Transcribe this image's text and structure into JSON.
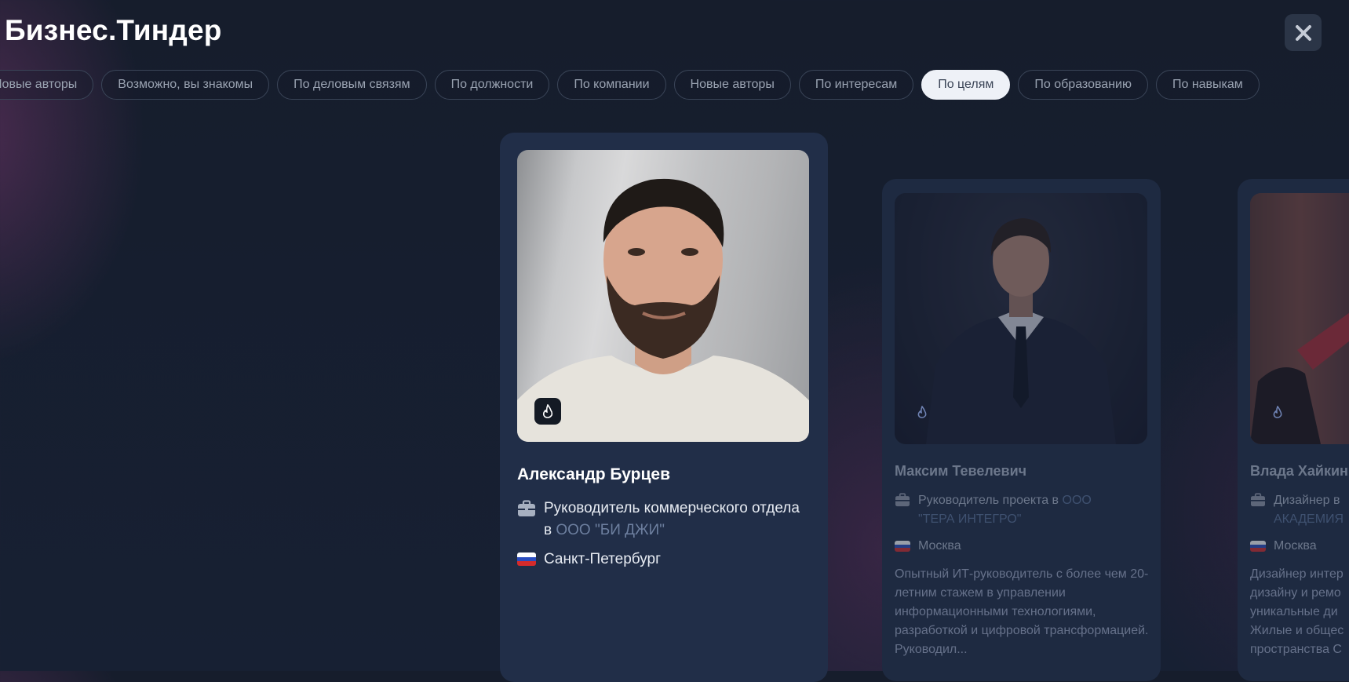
{
  "header": {
    "title": "Бизнес.Тиндер",
    "close_icon": "close-icon"
  },
  "filters": [
    {
      "label": "Новые авторы",
      "active": false
    },
    {
      "label": "Возможно, вы знакомы",
      "active": false
    },
    {
      "label": "По деловым связям",
      "active": false
    },
    {
      "label": "По должности",
      "active": false
    },
    {
      "label": "По компании",
      "active": false
    },
    {
      "label": "Новые авторы",
      "active": false
    },
    {
      "label": "По интересам",
      "active": false
    },
    {
      "label": "По целям",
      "active": true
    },
    {
      "label": "По образованию",
      "active": false
    },
    {
      "label": "По навыкам",
      "active": false
    }
  ],
  "cards": {
    "main": {
      "name": "Александр Бурцев",
      "job_prefix": "Руководитель коммерческого отдела в ",
      "company": "ООО \"БИ ДЖИ\"",
      "city": "Санкт-Петербург",
      "badge_icon": "flame-icon"
    },
    "side1": {
      "name": "Максим Тевелевич",
      "job_prefix": "Руководитель проекта в ",
      "company": "ООО \"ТЕРА ИНТЕГРО\"",
      "city": "Москва",
      "bio": "Опытный ИТ-руководитель с более чем 20-летним стажем в управлении информационными технологиями, разработкой и цифровой трансформацией. Руководил..."
    },
    "side2": {
      "name": "Влада Хайкин",
      "job_prefix": "Дизайнер в ",
      "company": "АКАДЕМИЯ",
      "city": "Москва",
      "bio": "Дизайнер интер дизайну и ремо уникальные ди Жилые и общес пространства С"
    }
  },
  "colors": {
    "background": "#172033",
    "card": "#212e48",
    "active_chip": "#eef1f7",
    "company_link": "#6d7f9f"
  }
}
